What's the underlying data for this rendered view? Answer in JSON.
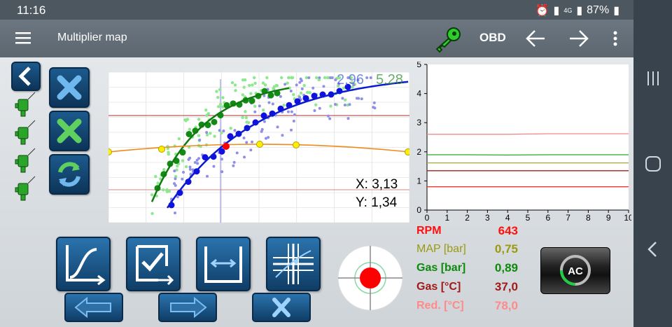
{
  "status": {
    "time": "11:16",
    "battery": "87%",
    "network": "4G"
  },
  "appbar": {
    "title": "Multiplier map",
    "obd_label": "OBD"
  },
  "main_chart": {
    "value_a": "2,96",
    "value_b": "5,28",
    "cursor": {
      "x_label": "X: 3,13",
      "y_label": "Y: 1,34"
    }
  },
  "readings": [
    {
      "label": "RPM",
      "value": "643",
      "color": "#ff1010"
    },
    {
      "label": "MAP [bar]",
      "value": "0,75",
      "color": "#9a9a10"
    },
    {
      "label": "Gas [bar]",
      "value": "0,89",
      "color": "#0b8a0b"
    },
    {
      "label": "Gas [°C]",
      "value": "37,0",
      "color": "#a11a1a"
    },
    {
      "label": "Red. [°C]",
      "value": "78,0",
      "color": "#ff8a8a"
    }
  ],
  "chart_data": {
    "type": "line",
    "title": "",
    "xlabel": "",
    "ylabel": "",
    "xlim": [
      0,
      10
    ],
    "ylim": [
      0,
      5
    ],
    "x_ticks": [
      "0",
      "1",
      "2",
      "3",
      "4",
      "5",
      "6",
      "7",
      "8",
      "9",
      "10"
    ],
    "y_ticks": [
      "0",
      "1",
      "2",
      "3",
      "4",
      "5"
    ],
    "series": [
      {
        "color": "#f08a8a",
        "x": [
          0,
          2,
          4,
          6,
          8,
          10
        ],
        "y": [
          2.6,
          2.6,
          2.6,
          2.62,
          2.62,
          2.62
        ]
      },
      {
        "color": "#2aa82a",
        "x": [
          0,
          2,
          4,
          6,
          8,
          10
        ],
        "y": [
          1.9,
          1.9,
          1.89,
          1.9,
          1.9,
          1.9
        ]
      },
      {
        "color": "#a8a838",
        "x": [
          0,
          2,
          4,
          6,
          8,
          10
        ],
        "y": [
          1.62,
          1.62,
          1.62,
          1.62,
          1.62,
          1.62
        ]
      },
      {
        "color": "#a12020",
        "x": [
          0,
          2,
          4,
          6,
          8,
          10
        ],
        "y": [
          1.35,
          1.35,
          1.35,
          1.35,
          1.35,
          1.35
        ]
      },
      {
        "color": "#ff3030",
        "x": [
          0,
          2,
          4,
          6,
          8,
          10
        ],
        "y": [
          0.8,
          0.8,
          0.8,
          0.8,
          0.8,
          0.8
        ]
      }
    ]
  }
}
